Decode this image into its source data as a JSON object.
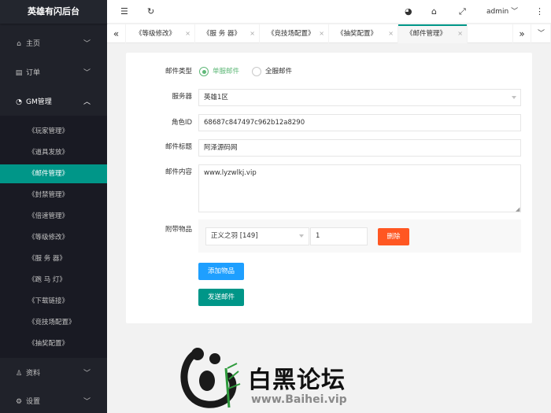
{
  "sidebar": {
    "brand": "英雄有闪后台",
    "items": [
      {
        "label": "主页",
        "icon": "home-icon"
      },
      {
        "label": "订单",
        "icon": "order-icon"
      },
      {
        "label": "GM管理",
        "icon": "dashboard-icon"
      },
      {
        "label": "资料",
        "icon": "user-icon"
      },
      {
        "label": "设置",
        "icon": "gear-icon"
      }
    ],
    "gm_sub": [
      "《玩家管理》",
      "《道具发放》",
      "《邮件管理》",
      "《封禁管理》",
      "《倍速管理》",
      "《等级修改》",
      "《服 务 器》",
      "《跑 马 灯》",
      "《下载链接》",
      "《竞技场配置》",
      "《抽奖配置》"
    ],
    "active_sub": "《邮件管理》"
  },
  "header": {
    "user": "admin"
  },
  "tabs": [
    {
      "label": "《等级修改》",
      "close": "×"
    },
    {
      "label": "《服 务 器》",
      "close": "×"
    },
    {
      "label": "《竞技场配置》",
      "close": "×"
    },
    {
      "label": "《抽奖配置》",
      "close": "×"
    },
    {
      "label": "《邮件管理》",
      "close": "×",
      "active": true
    }
  ],
  "form": {
    "mail_type_label": "邮件类型",
    "mail_type_options": [
      "单服邮件",
      "全服邮件"
    ],
    "mail_type_selected": "单服邮件",
    "server_label": "服务器",
    "server_value": "英雄1区",
    "role_id_label": "角色ID",
    "role_id_value": "68687c847497c962b12a8290",
    "title_label": "邮件标题",
    "title_value": "阿泽源码网",
    "content_label": "邮件内容",
    "content_value": "www.lyzwlkj.vip",
    "attach_label": "附带物品",
    "attach_item": "正义之羽 [149]",
    "attach_qty": "1",
    "delete_label": "删除",
    "add_item_label": "添加物品",
    "send_label": "发送邮件"
  },
  "watermark": {
    "title": "白黑论坛",
    "url": "www.Baihei.vip"
  },
  "colors": {
    "accent": "#009688",
    "radio": "#5fb878",
    "add_button": "#1e9fff",
    "delete_button": "#ff5722",
    "sidebar_bg": "#20222a"
  }
}
